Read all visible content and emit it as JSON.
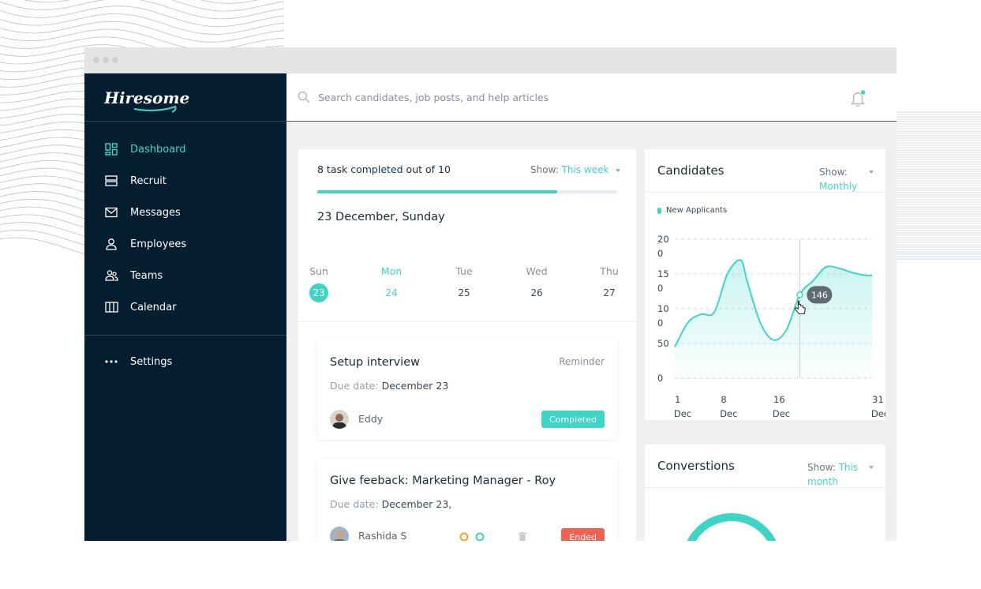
{
  "app": {
    "logo_text": "Hiresome!"
  },
  "sidebar": {
    "items": [
      {
        "label": "Dashboard",
        "icon": "dashboard-icon",
        "active": true
      },
      {
        "label": "Recruit",
        "icon": "recruit-icon"
      },
      {
        "label": "Messages",
        "icon": "mail-icon"
      },
      {
        "label": "Employees",
        "icon": "user-icon"
      },
      {
        "label": "Teams",
        "icon": "team-icon"
      },
      {
        "label": "Calendar",
        "icon": "calendar-icon"
      }
    ],
    "settings": {
      "label": "Settings",
      "icon": "more-dots-icon"
    }
  },
  "search": {
    "placeholder": "Search candidates, job posts, and help articles"
  },
  "notifications": {
    "icon": "bell-icon",
    "has_unread": true
  },
  "tasks": {
    "summary_prefix": "8 task",
    "summary_highlight": "completed",
    "summary_suffix": "out of 10",
    "completed": 8,
    "total": 10,
    "show_label": "Show:",
    "show_value": "This week",
    "date_title": "23 December, Sunday",
    "days": [
      {
        "name": "Sun",
        "num": "23",
        "selected": true
      },
      {
        "name": "Mon",
        "num": "24",
        "highlight": true
      },
      {
        "name": "Tue",
        "num": "25"
      },
      {
        "name": "Wed",
        "num": "26"
      },
      {
        "name": "Thu",
        "num": "27"
      }
    ],
    "items": [
      {
        "title": "Setup interview",
        "tag": "Reminder",
        "due_label": "Due date:",
        "due_value": "December 23",
        "person": "Eddy",
        "status": "Completed"
      },
      {
        "title": "Give feeback: Marketing Manager - Roy",
        "due_label": "Due date:",
        "due_value": "December 23,",
        "person": "Rashida S",
        "status": "Ended"
      }
    ]
  },
  "candidates": {
    "title": "Candidates",
    "show_label": "Show:",
    "show_value": "Monthly",
    "tooltip_value": "146",
    "colors": {
      "accent": "#3dd6c6",
      "tooltip": "#5f6b73"
    }
  },
  "conversions": {
    "title": "Converstions",
    "show_label": "Show:",
    "show_value_1": "This",
    "show_value_2": "month"
  },
  "chart_data": {
    "type": "area",
    "series": [
      {
        "name": "New Applicants",
        "x": [
          1,
          3,
          5,
          7,
          9,
          11,
          12,
          14,
          16,
          18,
          20,
          22,
          24,
          26,
          28,
          30,
          31
        ],
        "values": [
          45,
          80,
          92,
          95,
          150,
          170,
          140,
          80,
          55,
          70,
          120,
          140,
          160,
          158,
          152,
          148,
          148
        ]
      }
    ],
    "y_ticks": [
      "20\n0",
      "15\n0",
      "10\n0",
      "50",
      "0"
    ],
    "y_ticks_lines": [
      [
        "20",
        "0"
      ],
      [
        "15",
        "0"
      ],
      [
        "10",
        "0"
      ],
      [
        "50"
      ],
      [
        "0"
      ]
    ],
    "x_ticks": [
      [
        "1",
        "Dec"
      ],
      [
        "8",
        "Dec"
      ],
      [
        "16",
        "Dec"
      ],
      [
        "31",
        "Dec"
      ]
    ],
    "ylim": [
      0,
      200
    ],
    "xlim": [
      1,
      31
    ],
    "grid": "dashed-horizontal",
    "legend": "top-left"
  }
}
